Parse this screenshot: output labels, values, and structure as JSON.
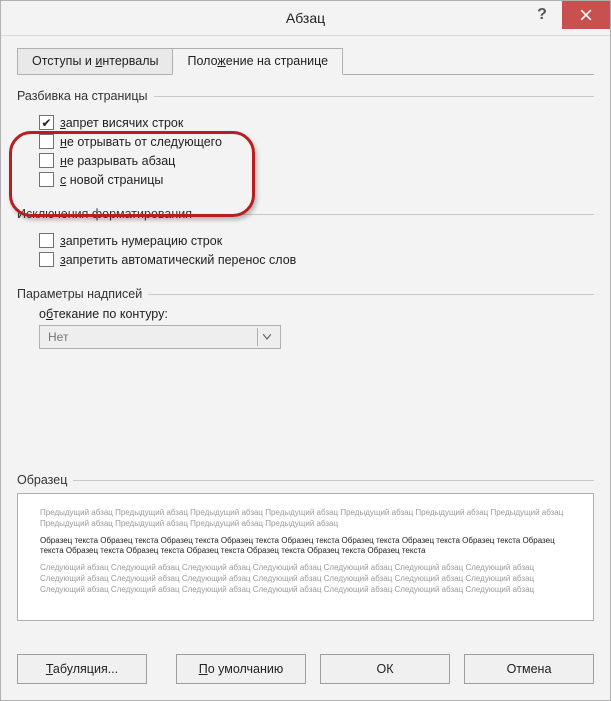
{
  "title": "Абзац",
  "tabs": {
    "indents": {
      "prefix": "Отступы и ",
      "accel": "и",
      "suffix": "нтервалы"
    },
    "position": {
      "prefix": "Поло",
      "accel": "ж",
      "suffix": "ение на странице"
    }
  },
  "groups": {
    "pagination": {
      "title": "Разбивка на страницы",
      "widow": {
        "checked": true,
        "prefix": "",
        "accel": "з",
        "suffix": "апрет висячих строк"
      },
      "keepNext": {
        "checked": false,
        "prefix": "",
        "accel": "н",
        "suffix": "е отрывать от следующего"
      },
      "keepTog": {
        "checked": false,
        "prefix": "",
        "accel": "н",
        "suffix": "е разрывать абзац"
      },
      "pageBrk": {
        "checked": false,
        "prefix": "",
        "accel": "с",
        "suffix": " новой страницы"
      }
    },
    "formatting": {
      "title": "Исключения форматирования",
      "noLineNum": {
        "checked": false,
        "prefix": "",
        "accel": "з",
        "suffix": "апретить нумерацию строк"
      },
      "noHyphen": {
        "checked": false,
        "prefix": "",
        "accel": "з",
        "suffix": "апретить автоматический перенос слов"
      }
    },
    "textbox": {
      "title": "Параметры надписей",
      "wrapLabel": {
        "prefix": "о",
        "accel": "б",
        "suffix": "текание по контуру:"
      },
      "wrapValue": "Нет"
    },
    "preview": {
      "title": "Образец",
      "prev": "Предыдущий абзац Предыдущий абзац Предыдущий абзац Предыдущий абзац Предыдущий абзац Предыдущий абзац Предыдущий абзац Предыдущий абзац Предыдущий абзац Предыдущий абзац Предыдущий абзац",
      "sample": "Образец текста Образец текста Образец текста Образец текста Образец текста Образец текста Образец текста Образец текста Образец текста Образец текста Образец текста Образец текста Образец текста Образец текста Образец текста",
      "next": "Следующий абзац Следующий абзац Следующий абзац Следующий абзац Следующий абзац Следующий абзац Следующий абзац Следующий абзац Следующий абзац Следующий абзац Следующий абзац Следующий абзац Следующий абзац Следующий абзац Следующий абзац Следующий абзац Следующий абзац Следующий абзац Следующий абзац Следующий абзац Следующий абзац"
    }
  },
  "buttons": {
    "tabs": {
      "accel": "Т",
      "suffix": "абуляция..."
    },
    "default": {
      "prefix": "",
      "accel": "П",
      "suffix": "о умолчанию"
    },
    "ok": "ОК",
    "cancel": "Отмена"
  }
}
